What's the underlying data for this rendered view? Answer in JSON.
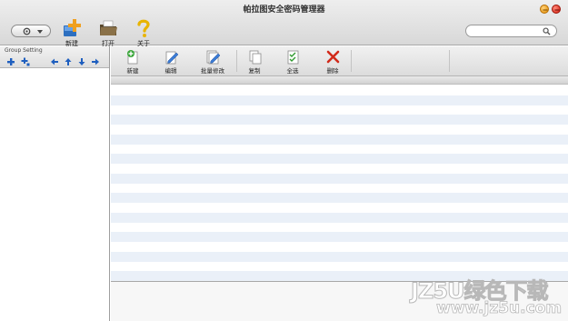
{
  "window": {
    "title": "帕拉图安全密码管理器"
  },
  "toolbar": {
    "new_label": "新建",
    "open_label": "打开",
    "about_label": "关于"
  },
  "search": {
    "value": "",
    "placeholder": ""
  },
  "group_panel": {
    "title": "Group Setting"
  },
  "main_toolbar": {
    "new_label": "新建",
    "edit_label": "编辑",
    "batch_edit_label": "批量修改",
    "copy_label": "复制",
    "select_all_label": "全选",
    "delete_label": "删除"
  },
  "watermark": {
    "line1": "JZ5U绿色下载",
    "line2": "www.jz5u.com"
  },
  "colors": {
    "row_stripe": "#eaf0f8",
    "close_button": "#d21c0c",
    "minimize_button": "#e08a00",
    "group_tool_blue": "#1f5fbf"
  }
}
